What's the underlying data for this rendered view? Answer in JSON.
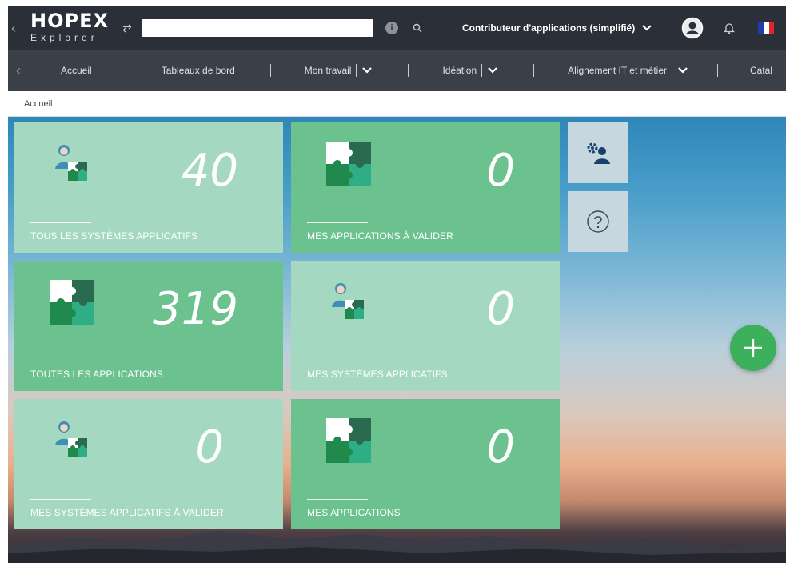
{
  "app": {
    "logo_main": "HOPEX",
    "logo_sub": "Explorer"
  },
  "topbar": {
    "search": {
      "value": "",
      "placeholder": ""
    },
    "profile_label": "Contributeur d'applications (simplifié)"
  },
  "nav": {
    "items": [
      {
        "label": "Accueil",
        "has_dropdown": false
      },
      {
        "label": "Tableaux de bord",
        "has_dropdown": false
      },
      {
        "label": "Mon travail",
        "has_dropdown": true
      },
      {
        "label": "Idéation",
        "has_dropdown": true
      },
      {
        "label": "Alignement IT et métier",
        "has_dropdown": true
      },
      {
        "label": "Catal",
        "has_dropdown": false
      }
    ]
  },
  "breadcrumb": {
    "current": "Accueil"
  },
  "tiles": [
    {
      "count": "40",
      "label": "TOUS LES SYSTÈMES APPLICATIFS",
      "icon": "user-puzzle-icon"
    },
    {
      "count": "0",
      "label": "MES APPLICATIONS À VALIDER",
      "icon": "puzzle-icon"
    },
    {
      "count": "319",
      "label": "TOUTES LES APPLICATIONS",
      "icon": "puzzle-icon"
    },
    {
      "count": "0",
      "label": "MES SYSTÈMES APPLICATIFS",
      "icon": "user-puzzle-icon"
    },
    {
      "count": "0",
      "label": "MES SYSTÈMES APPLICATIFS À VALIDER",
      "icon": "user-puzzle-icon"
    },
    {
      "count": "0",
      "label": "MES APPLICATIONS",
      "icon": "puzzle-icon"
    }
  ],
  "side_buttons": [
    {
      "icon": "user-settings-icon"
    },
    {
      "icon": "help-icon"
    }
  ],
  "colors": {
    "topbar": "#2b2f38",
    "navbar": "#3a3f48",
    "tile_light": "#a4d8c0",
    "tile_dark": "#6cc28f",
    "fab": "#3cb05a"
  },
  "language_flag": "fr-flag-icon"
}
